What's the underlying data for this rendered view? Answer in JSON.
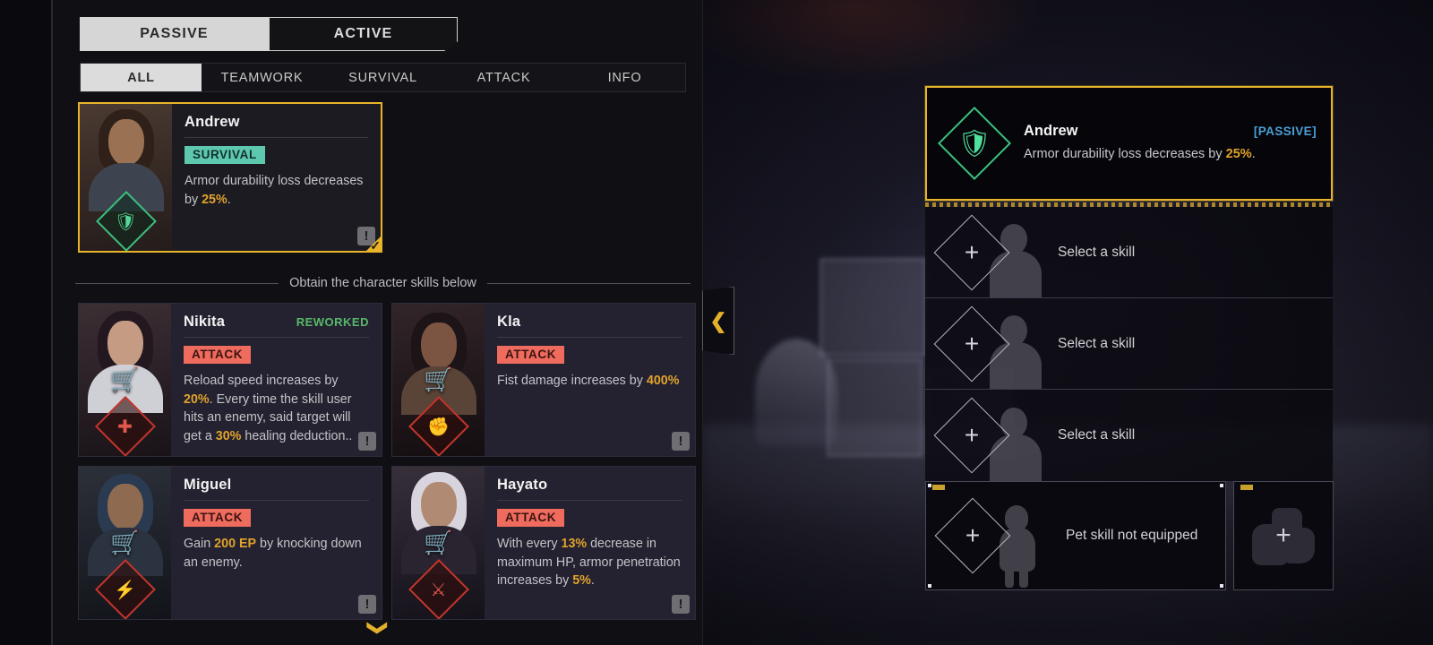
{
  "mode_toggle": {
    "passive_label": "PASSIVE",
    "active_label": "ACTIVE",
    "selected": "PASSIVE"
  },
  "category_tabs": [
    {
      "label": "ALL",
      "selected": true
    },
    {
      "label": "TEAMWORK",
      "selected": false
    },
    {
      "label": "SURVIVAL",
      "selected": false
    },
    {
      "label": "ATTACK",
      "selected": false
    },
    {
      "label": "INFO",
      "selected": false
    }
  ],
  "selected_skill": {
    "name": "Andrew",
    "badge": "SURVIVAL",
    "badge_color": "#5ec8ae",
    "desc_before": "Armor durability loss decreases by ",
    "desc_value": "25%",
    "desc_after": ".",
    "info_icon": "!",
    "check_icon": "✓"
  },
  "divider_label": "Obtain the character skills below",
  "obtainable_skills": [
    {
      "name": "Nikita",
      "tag": "REWORKED",
      "badge": "ATTACK",
      "desc_1": "Reload speed increases by ",
      "val_1": "20%",
      "desc_2": ". Every time the skill user hits an enemy, said target will get a ",
      "val_2": "30%",
      "desc_3": " healing deduction..",
      "cart_icon": "🛒",
      "info_icon": "!"
    },
    {
      "name": "Kla",
      "tag": "",
      "badge": "ATTACK",
      "desc_1": "Fist damage increases by ",
      "val_1": "400%",
      "desc_2": "",
      "val_2": "",
      "desc_3": "",
      "cart_icon": "🛒",
      "info_icon": "!"
    },
    {
      "name": "Miguel",
      "tag": "",
      "badge": "ATTACK",
      "desc_1": "Gain ",
      "val_1": "200 EP",
      "desc_2": " by knocking down an enemy.",
      "val_2": "",
      "desc_3": "",
      "cart_icon": "🛒",
      "info_icon": "!"
    },
    {
      "name": "Hayato",
      "tag": "",
      "badge": "ATTACK",
      "desc_1": "With every ",
      "val_1": "13%",
      "desc_2": " decrease in maximum HP, armor penetration increases by ",
      "val_2": "5%",
      "desc_3": ".",
      "cart_icon": "🛒",
      "info_icon": "!"
    }
  ],
  "scroll_down_icon": "❯",
  "collapse_icon": "❮",
  "loadout": {
    "equipped": {
      "name": "Andrew",
      "type": "[PASSIVE]",
      "type_color": "#4a9fd8",
      "desc_before": "Armor durability loss decreases by ",
      "desc_value": "25%",
      "desc_after": "."
    },
    "empty_slots": [
      {
        "label": "Select a skill",
        "plus": "+"
      },
      {
        "label": "Select a skill",
        "plus": "+"
      },
      {
        "label": "Select a skill",
        "plus": "+"
      }
    ],
    "pet_slot": {
      "label": "Pet skill not equipped",
      "plus": "+"
    },
    "gear_slot": {
      "plus": "+"
    }
  },
  "accent_colors": {
    "gold": "#e8b42a",
    "value_highlight": "#e0a32c",
    "attack_badge": "#ef6b5e",
    "survival_badge": "#5ec8ae",
    "reworked": "#56b869",
    "passive_blue": "#4a9fd8"
  }
}
